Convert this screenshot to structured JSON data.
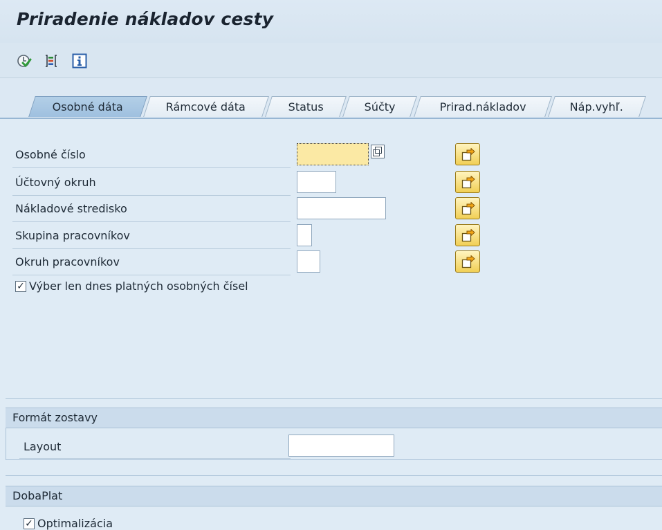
{
  "window": {
    "title": "Priradenie nákladov cesty"
  },
  "toolbar": {
    "icons": [
      "execute-icon",
      "variant-icon",
      "info-icon"
    ]
  },
  "tabs": [
    {
      "label": "Osobné dáta",
      "active": true
    },
    {
      "label": "Rámcové dáta",
      "active": false
    },
    {
      "label": "Status",
      "active": false
    },
    {
      "label": "Súčty",
      "active": false
    },
    {
      "label": "Prirad.nákladov",
      "active": false
    },
    {
      "label": "Náp.vyhľ.",
      "active": false
    }
  ],
  "selection": {
    "fields": [
      {
        "label": "Osobné číslo",
        "value": ""
      },
      {
        "label": "Účtovný okruh",
        "value": ""
      },
      {
        "label": "Nákladové stredisko",
        "value": ""
      },
      {
        "label": "Skupina pracovníkov",
        "value": ""
      },
      {
        "label": "Okruh pracovníkov",
        "value": ""
      }
    ],
    "checkbox": {
      "label": "Výber len dnes platných osobných čísel",
      "checked": true
    }
  },
  "format": {
    "header": "Formát zostavy",
    "layout_label": "Layout",
    "layout_value": ""
  },
  "doba": {
    "header": "DobaPlat",
    "checkbox": {
      "label": "Optimalizácia",
      "checked": true
    }
  },
  "colors": {
    "background": "#dfebf5",
    "active_tab": "#a9c7e3",
    "focus_field": "#fbe9a4",
    "multi_button": "#f1cf55"
  }
}
